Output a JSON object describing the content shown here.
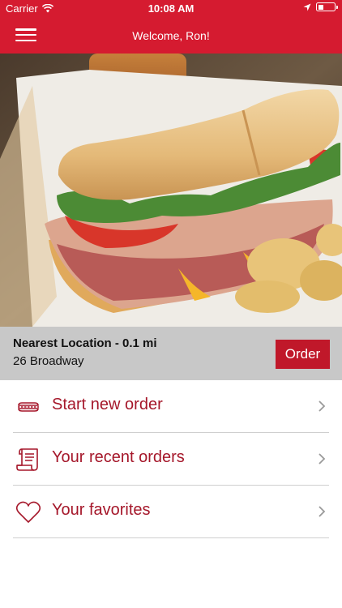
{
  "status_bar": {
    "carrier": "Carrier",
    "time": "10:08 AM",
    "battery_level": 0.3
  },
  "nav": {
    "title": "Welcome, Ron!",
    "menu_icon": "hamburger-icon"
  },
  "hero": {
    "image": "sub-sandwich-photo"
  },
  "location": {
    "title": "Nearest Location - 0.1 mi",
    "address": "26 Broadway",
    "order_label": "Order"
  },
  "menu": {
    "items": [
      {
        "label": "Start new order",
        "icon": "sandwich-icon"
      },
      {
        "label": "Your recent orders",
        "icon": "receipt-icon"
      },
      {
        "label": "Your favorites",
        "icon": "heart-icon"
      }
    ]
  },
  "colors": {
    "brand_red": "#d51b30",
    "accent_red": "#a5172a",
    "location_bar_gray": "#c8c8c8"
  }
}
